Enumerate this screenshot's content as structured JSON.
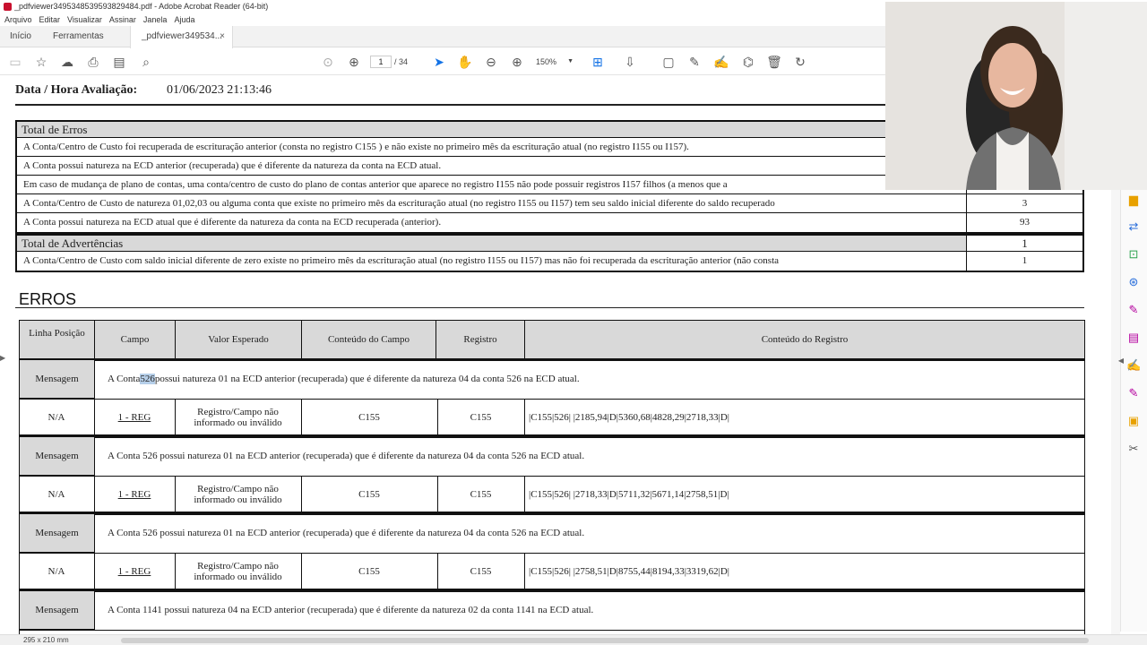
{
  "window": {
    "title": "_pdfviewer34953485395938294​84.pdf - Adobe Acrobat Reader (64-bit)"
  },
  "menu": [
    "Arquivo",
    "Editar",
    "Visualizar",
    "Assinar",
    "Janela",
    "Ajuda"
  ],
  "tabs": {
    "home": "Início",
    "tools": "Ferramentas",
    "doc": "_pdfviewer349534...",
    "close": "×"
  },
  "toolbar": {
    "page_current": "1",
    "page_total": "/ 34",
    "zoom": "150%"
  },
  "document": {
    "eval_label": "Data / Hora Avaliação:",
    "eval_value": "01/06/2023 21:13:46",
    "errors_summary": {
      "title": "Total de Erros",
      "rows": [
        {
          "text": "A Conta/Centro de Custo foi recuperada de escrituração anterior (consta no registro C155 ) e não existe  no primeiro mês da escrituração atual (no registro I155 ou I157).",
          "count": ""
        },
        {
          "text": "A Conta possui natureza na ECD anterior (recuperada) que é diferente da natureza da conta na ECD atual.",
          "count": ""
        },
        {
          "text": "Em caso de mudança de plano de contas, uma conta/centro de custo do plano de contas anterior que aparece no registro I155 não pode possuir registros I157 filhos (a menos que a",
          "count": ""
        },
        {
          "text": "A Conta/Centro de Custo de natureza 01,02,03 ou alguma conta que existe no primeiro mês da escrituração atual (no registro I155 ou I157) tem seu saldo inicial diferente do saldo recuperado",
          "count": "3"
        },
        {
          "text": "A Conta possui natureza na ECD atual que é diferente da natureza da conta na ECD recuperada (anterior).",
          "count": "93"
        }
      ]
    },
    "warnings_summary": {
      "title": "Total de Advertências",
      "count": "1",
      "rows": [
        {
          "text": "A Conta/Centro de Custo com saldo inicial diferente de zero existe no primeiro mês da escrituração atual (no registro I155 ou I157) mas não foi recuperada da escrituração anterior (não consta",
          "count": "1"
        }
      ]
    },
    "section_title": "ERROS",
    "table": {
      "headers": [
        "Linha Posição",
        "Campo",
        "Valor Esperado",
        "Conteúdo do Campo",
        "Registro",
        "Conteúdo do Registro"
      ],
      "message_label": "Mensagem",
      "groups": [
        {
          "msg_pre": "A Conta ",
          "msg_hl": "526",
          "msg_post": " possui natureza 01 na ECD anterior (recuperada) que é diferente da natureza 04 da conta 526 na ECD atual.",
          "linha": "N/A",
          "campo": "1 - REG",
          "valor": "Registro/Campo não informado ou inválido",
          "conteudo": "C155",
          "registro": "C155",
          "conteudo_registro": "|C155|526| |2185,94|D|5360,68|4828,29|2718,33|D|"
        },
        {
          "msg_pre": "A Conta 526 possui natureza 01 na ECD anterior (recuperada) que é diferente da natureza 04 da conta 526 na ECD atual.",
          "msg_hl": "",
          "msg_post": "",
          "linha": "N/A",
          "campo": "1 - REG",
          "valor": "Registro/Campo não informado ou inválido",
          "conteudo": "C155",
          "registro": "C155",
          "conteudo_registro": "|C155|526| |2718,33|D|5711,32|5671,14|2758,51|D|"
        },
        {
          "msg_pre": "A Conta 526 possui natureza 01 na ECD anterior (recuperada) que é diferente da natureza 04 da conta 526 na ECD atual.",
          "msg_hl": "",
          "msg_post": "",
          "linha": "N/A",
          "campo": "1 - REG",
          "valor": "Registro/Campo não informado ou inválido",
          "conteudo": "C155",
          "registro": "C155",
          "conteudo_registro": "|C155|526| |2758,51|D|8755,44|8194,33|3319,62|D|"
        },
        {
          "msg_pre": "A Conta 1141 possui natureza 04 na ECD anterior (recuperada) que é diferente da natureza 02 da conta 1141 na ECD atual.",
          "msg_hl": "",
          "msg_post": ""
        }
      ]
    }
  },
  "status": {
    "dimensions": "295 x 210 mm"
  }
}
